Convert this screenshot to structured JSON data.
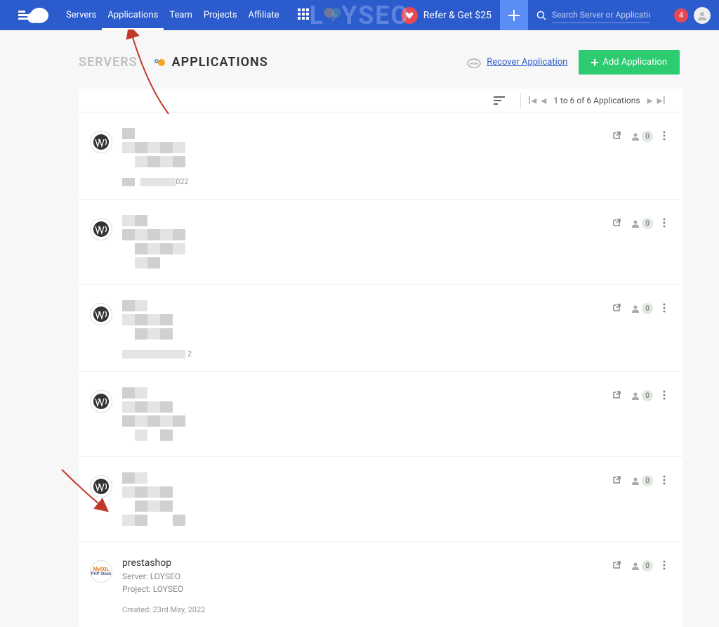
{
  "nav": {
    "items": [
      {
        "label": "Servers"
      },
      {
        "label": "Applications"
      },
      {
        "label": "Team"
      },
      {
        "label": "Projects"
      },
      {
        "label": "Affiliate"
      }
    ],
    "active_index": 1
  },
  "refer": {
    "text": "Refer & Get $25"
  },
  "search": {
    "placeholder": "Search Server or Application"
  },
  "notification_count": "4",
  "watermark": {
    "left": "L",
    "right": "YSEO"
  },
  "tabs": {
    "servers_label": "SERVERS",
    "applications_label": "APPLICATIONS"
  },
  "recover_label": "Recover Application",
  "add_application_label": "Add Application",
  "pagination": {
    "text": "1 to 6 of 6 Applications"
  },
  "apps": [
    {
      "type": "wordpress",
      "blurred": true,
      "created_suffix": "022",
      "user_count": "0"
    },
    {
      "type": "wordpress",
      "blurred": true,
      "user_count": "0"
    },
    {
      "type": "wordpress",
      "blurred": true,
      "created_suffix": "2",
      "user_count": "0"
    },
    {
      "type": "wordpress",
      "blurred": true,
      "user_count": "0"
    },
    {
      "type": "wordpress",
      "blurred": true,
      "user_count": "0"
    },
    {
      "type": "phpstack",
      "blurred": false,
      "name": "prestashop",
      "server_line": "Server: LOYSEO",
      "project_line": "Project: LOYSEO",
      "created": "Created: 23rd May, 2022",
      "user_count": "0"
    }
  ],
  "icons": {
    "stack_top": "MySQL",
    "stack_bottom": "PHP Stack"
  }
}
